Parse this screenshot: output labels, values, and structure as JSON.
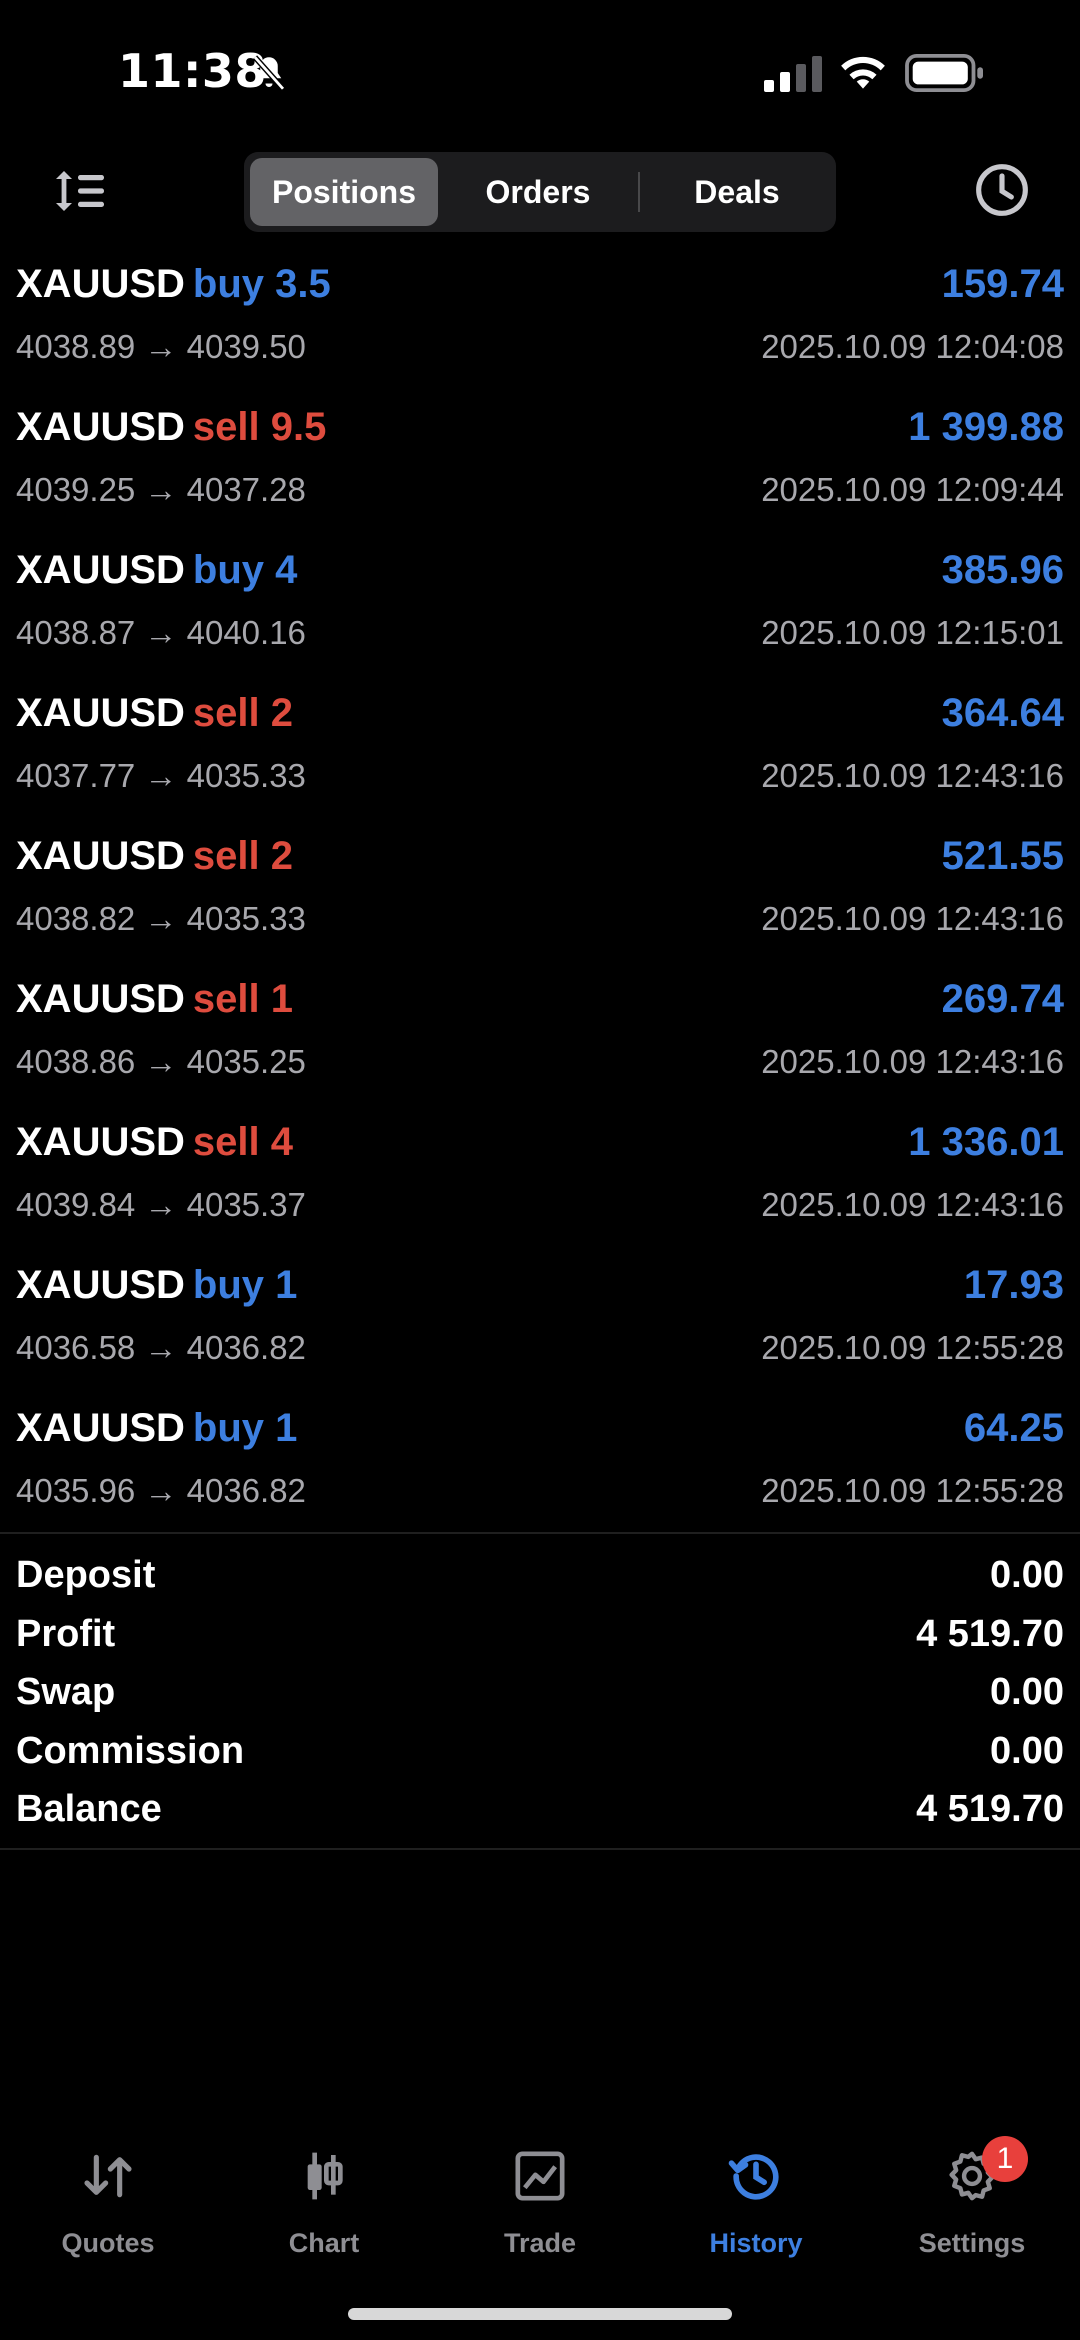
{
  "status_bar": {
    "time": "11:38"
  },
  "tabs": {
    "positions": "Positions",
    "orders": "Orders",
    "deals": "Deals"
  },
  "deals": [
    {
      "symbol": "XAUUSD",
      "side": "buy 3.5",
      "side_type": "buy",
      "profit": "159.74",
      "prices": "4038.89 → 4039.50",
      "time": "2025.10.09 12:04:08"
    },
    {
      "symbol": "XAUUSD",
      "side": "sell 9.5",
      "side_type": "sell",
      "profit": "1 399.88",
      "prices": "4039.25 → 4037.28",
      "time": "2025.10.09 12:09:44"
    },
    {
      "symbol": "XAUUSD",
      "side": "buy 4",
      "side_type": "buy",
      "profit": "385.96",
      "prices": "4038.87 → 4040.16",
      "time": "2025.10.09 12:15:01"
    },
    {
      "symbol": "XAUUSD",
      "side": "sell 2",
      "side_type": "sell",
      "profit": "364.64",
      "prices": "4037.77 → 4035.33",
      "time": "2025.10.09 12:43:16"
    },
    {
      "symbol": "XAUUSD",
      "side": "sell 2",
      "side_type": "sell",
      "profit": "521.55",
      "prices": "4038.82 → 4035.33",
      "time": "2025.10.09 12:43:16"
    },
    {
      "symbol": "XAUUSD",
      "side": "sell 1",
      "side_type": "sell",
      "profit": "269.74",
      "prices": "4038.86 → 4035.25",
      "time": "2025.10.09 12:43:16"
    },
    {
      "symbol": "XAUUSD",
      "side": "sell 4",
      "side_type": "sell",
      "profit": "1 336.01",
      "prices": "4039.84 → 4035.37",
      "time": "2025.10.09 12:43:16"
    },
    {
      "symbol": "XAUUSD",
      "side": "buy 1",
      "side_type": "buy",
      "profit": "17.93",
      "prices": "4036.58 → 4036.82",
      "time": "2025.10.09 12:55:28"
    },
    {
      "symbol": "XAUUSD",
      "side": "buy 1",
      "side_type": "buy",
      "profit": "64.25",
      "prices": "4035.96 → 4036.82",
      "time": "2025.10.09 12:55:28"
    }
  ],
  "summary": [
    {
      "label": "Deposit",
      "value": "0.00"
    },
    {
      "label": "Profit",
      "value": "4 519.70"
    },
    {
      "label": "Swap",
      "value": "0.00"
    },
    {
      "label": "Commission",
      "value": "0.00"
    },
    {
      "label": "Balance",
      "value": "4 519.70"
    }
  ],
  "tabbar": {
    "quotes": "Quotes",
    "chart": "Chart",
    "trade": "Trade",
    "history": "History",
    "settings": "Settings",
    "settings_badge": "1"
  },
  "colors": {
    "buy": "#3d7fe0",
    "sell": "#de4c3e",
    "accent": "#3d7fe0",
    "badge": "#e8403c"
  },
  "icons": [
    "bell-muted-icon",
    "signal-icon",
    "wifi-icon",
    "battery-icon",
    "sort-icon",
    "clock-icon",
    "quotes-icon",
    "chart-icon",
    "trade-icon",
    "history-icon",
    "settings-icon"
  ]
}
